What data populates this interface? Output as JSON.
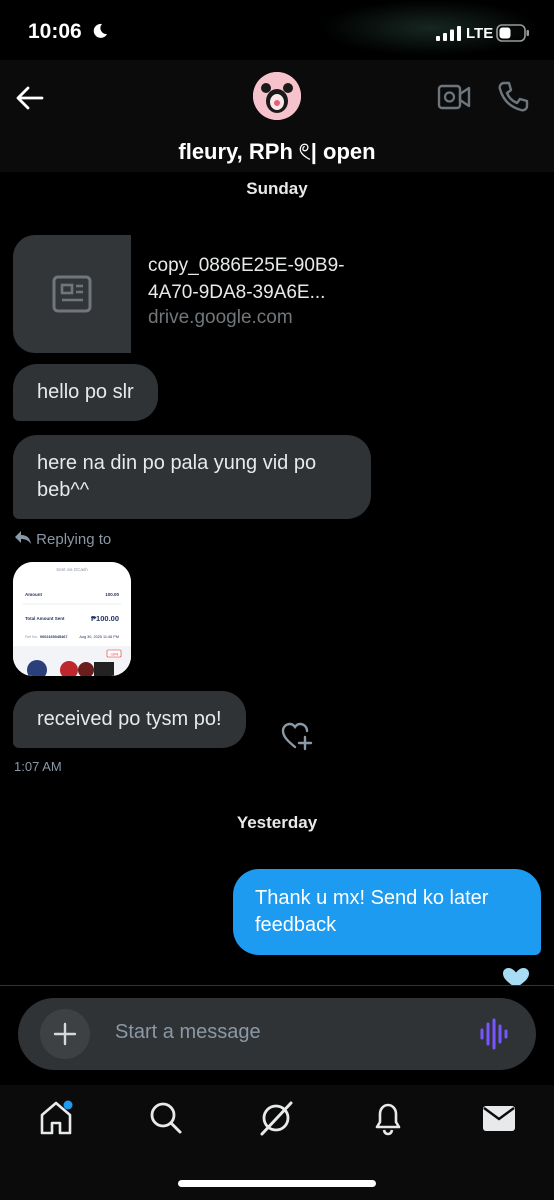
{
  "status_bar": {
    "time": "10:06",
    "network": "LTE"
  },
  "header": {
    "title": "fleury, RPh 𓏲| open"
  },
  "conversation": {
    "sunday_label": "Sunday",
    "link_card": {
      "title": "copy_0886E25E-90B9-4A70-9DA8-39A6E...",
      "domain": "drive.google.com"
    },
    "messages_in": [
      {
        "text": "hello po slr"
      },
      {
        "text": "here na din po pala yung vid po beb^^"
      },
      {
        "text": "received po tysm po!"
      }
    ],
    "replying_label": "Replying to",
    "time_stamp": "1:07 AM",
    "yesterday_label": "Yesterday",
    "message_out": {
      "text": "Thank u mx! Send ko later feedback"
    }
  },
  "reply_preview": {
    "header": "Sent via GCash",
    "amount_label": "Amount",
    "amount_value": "100.00",
    "total_label": "Total Amount Sent",
    "total_value": "₱100.00",
    "ref_label": "Ref No.",
    "ref_value": "0002165045467",
    "date": "Aug 30, 2025 11:46 PM",
    "tag": "-10%"
  },
  "composer": {
    "placeholder": "Start a message"
  },
  "colors": {
    "accent": "#1d9bf0",
    "bubble_in": "#2f3336",
    "voice": "#7856ff"
  },
  "icons": [
    "back-arrow-icon",
    "video-call-icon",
    "phone-icon",
    "article-icon",
    "reply-arrow-icon",
    "heart-plus-icon",
    "heart-icon",
    "plus-icon",
    "voice-wave-icon",
    "home-icon",
    "search-icon",
    "grok-icon",
    "bell-icon",
    "mail-icon"
  ]
}
